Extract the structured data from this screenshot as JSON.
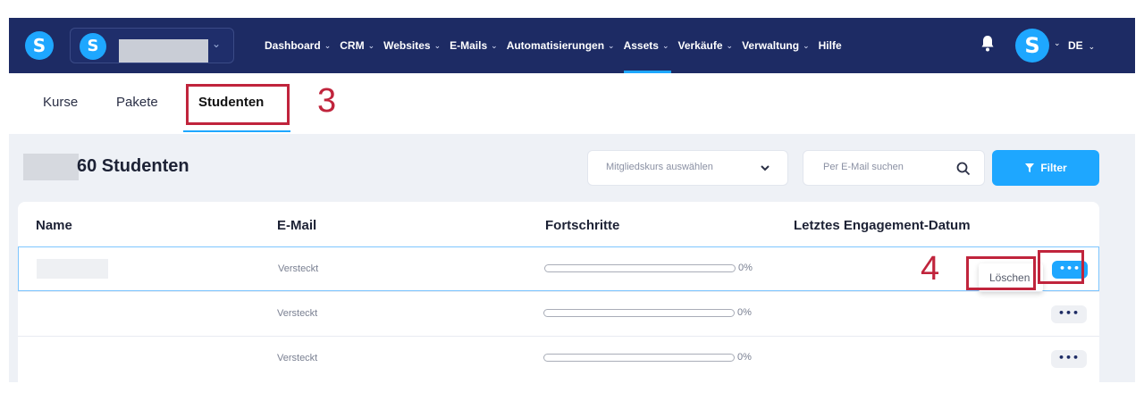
{
  "topbar": {
    "logo_letter": "S",
    "account_logo_letter": "S",
    "nav": [
      {
        "label": "Dashboard",
        "chevron": true,
        "active": false
      },
      {
        "label": "CRM",
        "chevron": true,
        "active": false
      },
      {
        "label": "Websites",
        "chevron": true,
        "active": false
      },
      {
        "label": "E-Mails",
        "chevron": true,
        "active": false
      },
      {
        "label": "Automatisierungen",
        "chevron": true,
        "active": false
      },
      {
        "label": "Assets",
        "chevron": true,
        "active": true
      },
      {
        "label": "Verkäufe",
        "chevron": true,
        "active": false
      },
      {
        "label": "Verwaltung",
        "chevron": true,
        "active": false
      },
      {
        "label": "Hilfe",
        "chevron": false,
        "active": false
      }
    ],
    "avatar_letter": "S",
    "language": "DE"
  },
  "tabs": [
    {
      "label": "Kurse",
      "active": false
    },
    {
      "label": "Pakete",
      "active": false
    },
    {
      "label": "Studenten",
      "active": true
    }
  ],
  "annotations": {
    "step_3": "3",
    "step_4": "4"
  },
  "content": {
    "title": "60 Studenten",
    "course_select_placeholder": "Mitgliedskurs auswählen",
    "email_search_placeholder": "Per E-Mail suchen",
    "filter_label": "Filter"
  },
  "table": {
    "headers": {
      "name": "Name",
      "email": "E-Mail",
      "progress": "Fortschritte",
      "last_engagement": "Letztes Engagement-Datum"
    },
    "rows": [
      {
        "email": "Versteckt",
        "progress_pct": 0,
        "progress_label": "0%",
        "actions": "•••",
        "selected": true
      },
      {
        "email": "Versteckt",
        "progress_pct": 0,
        "progress_label": "0%",
        "actions": "•••",
        "selected": false
      },
      {
        "email": "Versteckt",
        "progress_pct": 0,
        "progress_label": "0%",
        "actions": "•••",
        "selected": false
      }
    ],
    "row_menu": {
      "delete_label": "Löschen"
    }
  },
  "colors": {
    "navbar": "#1d2b64",
    "accent": "#1ea7ff",
    "annotation_red": "#c0243c",
    "content_bg": "#eef1f6"
  },
  "icons": [
    "bell-icon",
    "search-icon",
    "filter-funnel-icon",
    "chevron-down-icon",
    "more-dots-icon"
  ]
}
